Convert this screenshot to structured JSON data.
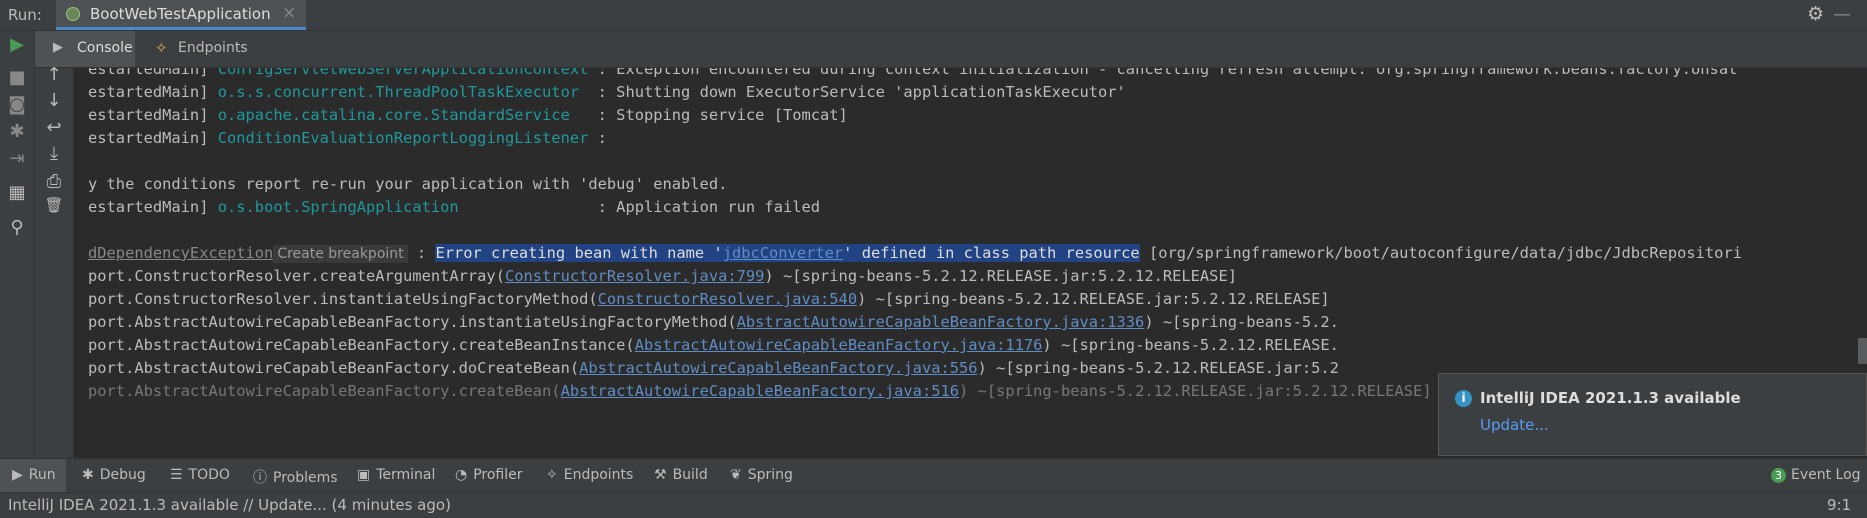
{
  "run_bar": {
    "label": "Run:",
    "tab_title": "BootWebTestApplication",
    "close_glyph": "×",
    "settings_glyph": "⚙",
    "minimize_glyph": "—"
  },
  "left_toolbar": [
    {
      "name": "run-icon",
      "glyph": "▶"
    },
    {
      "name": "stop-icon",
      "glyph": "■"
    },
    {
      "name": "camera-icon",
      "glyph": "◙"
    },
    {
      "name": "bug-icon",
      "glyph": "✱"
    },
    {
      "name": "exit-icon",
      "glyph": "⇥"
    },
    {
      "name": "layout-icon",
      "glyph": "▦"
    },
    {
      "name": "pin-icon",
      "glyph": "⚲"
    }
  ],
  "sub_tabs": {
    "console": "Console",
    "console_glyph": "▶",
    "endpoints": "Endpoints",
    "endpoints_glyph": "✧"
  },
  "console_toolbar": [
    {
      "name": "arrow-up-icon",
      "glyph": "↑"
    },
    {
      "name": "arrow-down-icon",
      "glyph": "↓"
    },
    {
      "name": "soft-wrap-icon",
      "glyph": "↩"
    },
    {
      "name": "scroll-to-end-icon",
      "glyph": "⤓"
    },
    {
      "name": "print-icon",
      "glyph": "⎙"
    },
    {
      "name": "trash-icon",
      "glyph": "🗑"
    }
  ],
  "console": {
    "l1": {
      "a": "estartedMain] ",
      "b": "ConfigServletWebServerApplicationContext",
      "c": " : Exception encountered during context initialization - cancelling refresh attempt: org.springframework.beans.factory.Unsat"
    },
    "l2": {
      "a": "estartedMain] ",
      "b": "o.s.s.concurrent.ThreadPoolTaskExecutor",
      "c": "  : Shutting down ExecutorService 'applicationTaskExecutor'"
    },
    "l3": {
      "a": "estartedMain] ",
      "b": "o.apache.catalina.core.StandardService",
      "c": "   : Stopping service [Tomcat]"
    },
    "l4": {
      "a": "estartedMain] ",
      "b": "ConditionEvaluationReportLoggingListener",
      "c": " :"
    },
    "l5": "y the conditions report re-run your application with 'debug' enabled.",
    "l6": {
      "a": "estartedMain] ",
      "b": "o.s.boot.SpringApplication",
      "c": "               : Application run failed"
    },
    "l7": {
      "exc": "dDependencyException",
      "breakpoint": "Create breakpoint",
      "colon": " : ",
      "sel1": "Error creating bean with name '",
      "sel_link": "jdbcConverter",
      "sel2": "' defined in class path resource",
      "rest": " [org/springframework/boot/autoconfigure/data/jdbc/JdbcRepositori"
    },
    "l8": {
      "a": "port.ConstructorResolver.createArgumentArray(",
      "link": "ConstructorResolver.java:799",
      "c": ") ~[spring-beans-5.2.12.RELEASE.jar:5.2.12.RELEASE]"
    },
    "l9": {
      "a": "port.ConstructorResolver.instantiateUsingFactoryMethod(",
      "link": "ConstructorResolver.java:540",
      "c": ") ~[spring-beans-5.2.12.RELEASE.jar:5.2.12.RELEASE]"
    },
    "l10": {
      "a": "port.AbstractAutowireCapableBeanFactory.instantiateUsingFactoryMethod(",
      "link": "AbstractAutowireCapableBeanFactory.java:1336",
      "c": ") ~[spring-beans-5.2."
    },
    "l11": {
      "a": "port.AbstractAutowireCapableBeanFactory.createBeanInstance(",
      "link": "AbstractAutowireCapableBeanFactory.java:1176",
      "c": ") ~[spring-beans-5.2.12.RELEASE."
    },
    "l12": {
      "a": "port.AbstractAutowireCapableBeanFactory.doCreateBean(",
      "link": "AbstractAutowireCapableBeanFactory.java:556",
      "c": ") ~[spring-beans-5.2.12.RELEASE.jar:5.2"
    },
    "l13": {
      "a": "port.AbstractAutowireCapableBeanFactory.createBean(",
      "link": "AbstractAutowireCapableBeanFactory.java:516",
      "c": ") ~[spring-beans-5.2.12.RELEASE.jar:5.2.12.RELEASE]"
    }
  },
  "notification": {
    "title": "IntelliJ IDEA 2021.1.3 available",
    "link": "Update...",
    "info_glyph": "i"
  },
  "bottom_tabs": {
    "run": "Run",
    "debug": "Debug",
    "todo": "TODO",
    "problems": "Problems",
    "terminal": "Terminal",
    "profiler": "Profiler",
    "endpoints": "Endpoints",
    "build": "Build",
    "spring": "Spring",
    "event_log": "Event Log",
    "event_log_count": "3"
  },
  "bottom_tab_icons": {
    "run": "▶",
    "debug": "✱",
    "todo": "☰",
    "problems": "ⓘ",
    "terminal": "▣",
    "profiler": "◔",
    "endpoints": "✧",
    "build": "⚒",
    "spring": "❦"
  },
  "status_bar": {
    "message": "IntelliJ IDEA 2021.1.3 available // Update... (4 minutes ago)",
    "caret_position": "9:1"
  },
  "colors": {
    "background": "#2b2b2b",
    "panel": "#3c3f41",
    "class_name": "#20999d",
    "link": "#5f8dc4",
    "selection": "#214283",
    "accent": "#4a88c7"
  }
}
